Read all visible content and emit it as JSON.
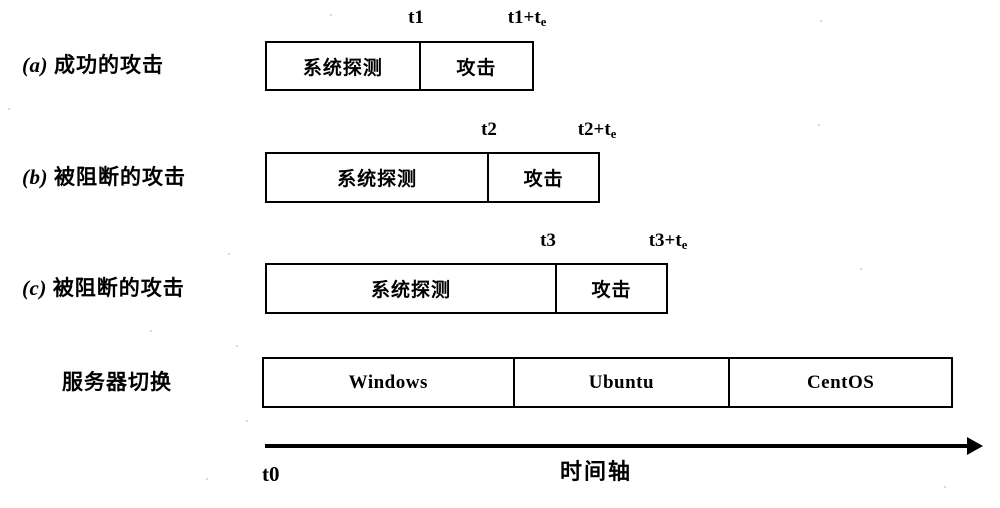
{
  "figure": {
    "background_color": "#ffffff",
    "ink_color": "#000000",
    "rows": [
      {
        "tag": "(a)",
        "label_cn": "成功的攻击",
        "segments": [
          {
            "text": "系统探测"
          },
          {
            "text": "攻击"
          }
        ],
        "markers": [
          {
            "text": "t1",
            "sub": ""
          },
          {
            "text": "t1+t",
            "sub": "e"
          }
        ]
      },
      {
        "tag": "(b)",
        "label_cn": "被阻断的攻击",
        "segments": [
          {
            "text": "系统探测"
          },
          {
            "text": "攻击"
          }
        ],
        "markers": [
          {
            "text": "t2",
            "sub": ""
          },
          {
            "text": "t2+t",
            "sub": "e"
          }
        ]
      },
      {
        "tag": "(c)",
        "label_cn": "被阻断的攻击",
        "segments": [
          {
            "text": "系统探测"
          },
          {
            "text": "攻击"
          }
        ],
        "markers": [
          {
            "text": "t3",
            "sub": ""
          },
          {
            "text": "t3+t",
            "sub": "e"
          }
        ]
      }
    ],
    "server_row": {
      "label_cn": "服务器切换",
      "segments": [
        {
          "text": "Windows"
        },
        {
          "text": "Ubuntu"
        },
        {
          "text": "CentOS"
        }
      ]
    },
    "axis": {
      "start_label": "t0",
      "title": "时间轴"
    }
  }
}
